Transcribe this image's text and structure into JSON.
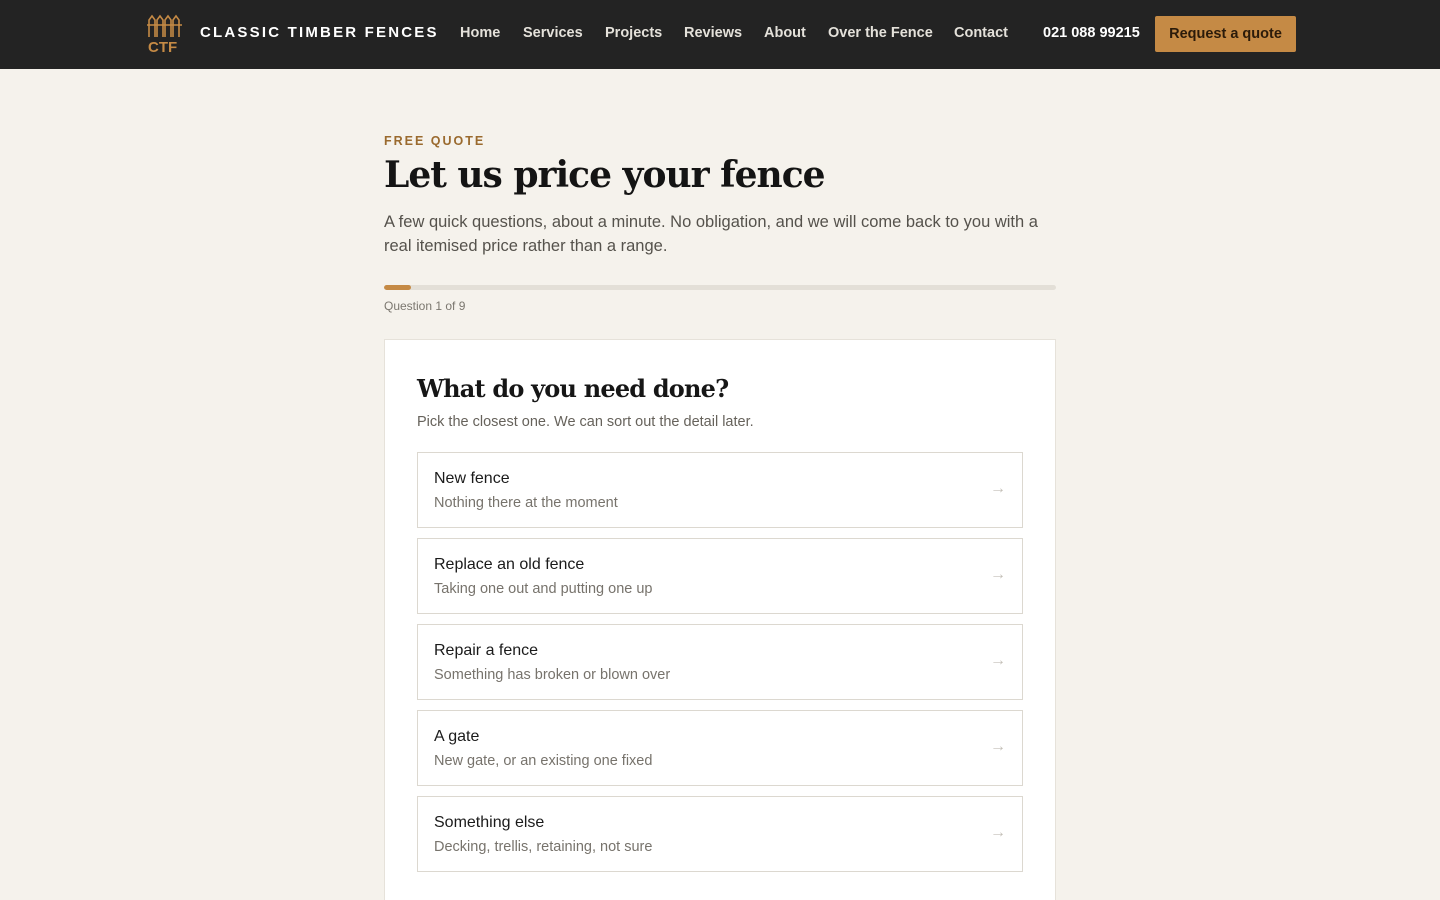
{
  "header": {
    "logo_text": "CTF",
    "brand": "CLASSIC TIMBER FENCES",
    "nav": [
      {
        "label": "Home"
      },
      {
        "label": "Services"
      },
      {
        "label": "Projects"
      },
      {
        "label": "Reviews"
      },
      {
        "label": "About"
      },
      {
        "label": "Over the Fence"
      },
      {
        "label": "Contact"
      }
    ],
    "phone": "021 088 99215",
    "cta_label": "Request a quote"
  },
  "hero": {
    "eyebrow": "FREE QUOTE",
    "title": "Let us price your fence",
    "intro": "A few quick questions, about a minute. No obligation, and we will come back to you with a real itemised price rather than a range."
  },
  "progress": {
    "label": "Question 1 of 9",
    "current": 1,
    "total": 9,
    "fraction": 0.04
  },
  "question": {
    "title": "What do you need done?",
    "subtitle": "Pick the closest one. We can sort out the detail later.",
    "options": [
      {
        "title": "New fence",
        "desc": "Nothing there at the moment"
      },
      {
        "title": "Replace an old fence",
        "desc": "Taking one out and putting one up"
      },
      {
        "title": "Repair a fence",
        "desc": "Something has broken or blown over"
      },
      {
        "title": "A gate",
        "desc": "New gate, or an existing one fixed"
      },
      {
        "title": "Something else",
        "desc": "Decking, trellis, retaining, not sure"
      }
    ],
    "arrow": "→"
  },
  "colors": {
    "accent": "#c58a45",
    "nav_bg": "#232323",
    "page_bg": "#f5f2ec"
  },
  "icons": {
    "logo": "fence-logo-icon",
    "option_arrow": "arrow-right-icon"
  }
}
